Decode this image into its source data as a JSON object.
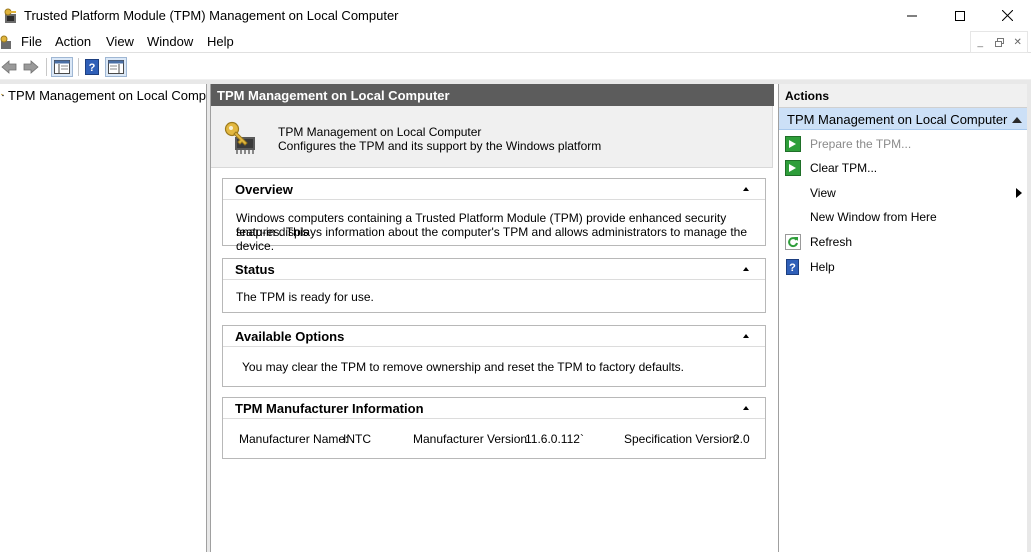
{
  "window": {
    "title": "Trusted Platform Module (TPM) Management on Local Computer"
  },
  "menu": {
    "items": [
      {
        "label": "File"
      },
      {
        "label": "Action"
      },
      {
        "label": "View"
      },
      {
        "label": "Window"
      },
      {
        "label": "Help"
      }
    ]
  },
  "tree": {
    "root_label": "TPM Management on Local Comp"
  },
  "center": {
    "header": "TPM Management on Local Computer",
    "intro_title": "TPM Management on Local Computer",
    "intro_desc": "Configures the TPM and its support by the Windows platform",
    "sections": {
      "overview": {
        "title": "Overview",
        "line1": "Windows computers containing a Trusted Platform Module (TPM) provide enhanced security features. This",
        "line2": "snap-in displays information about the computer's TPM and allows administrators to manage the device."
      },
      "status": {
        "title": "Status",
        "text": "The TPM is ready for use."
      },
      "options": {
        "title": "Available Options",
        "text": "You may clear the TPM to remove ownership and reset the TPM to factory defaults."
      },
      "manufacturer": {
        "title": "TPM Manufacturer Information",
        "name_label": "Manufacturer Name:",
        "name_value": "INTC",
        "version_label": "Manufacturer Version:",
        "version_value": "11.6.0.112`",
        "spec_label": "Specification Version:",
        "spec_value": "2.0"
      }
    }
  },
  "actions": {
    "header": "Actions",
    "group": "TPM Management on Local Computer",
    "items": [
      {
        "label": "Prepare the TPM...",
        "icon": "green-arrow-icon",
        "disabled": true
      },
      {
        "label": "Clear TPM...",
        "icon": "green-arrow-icon",
        "disabled": false
      },
      {
        "label": "View",
        "icon": "",
        "disabled": false,
        "submenu": true
      },
      {
        "label": "New Window from Here",
        "icon": "",
        "disabled": false
      },
      {
        "label": "Refresh",
        "icon": "refresh-icon",
        "disabled": false
      },
      {
        "label": "Help",
        "icon": "help-icon",
        "disabled": false
      }
    ]
  },
  "colors": {
    "center_header_bg": "#5c5c5c",
    "actions_group_bg": "#cce0f7",
    "action_green": "#2e9e3a",
    "help_blue": "#2f5fb8"
  }
}
